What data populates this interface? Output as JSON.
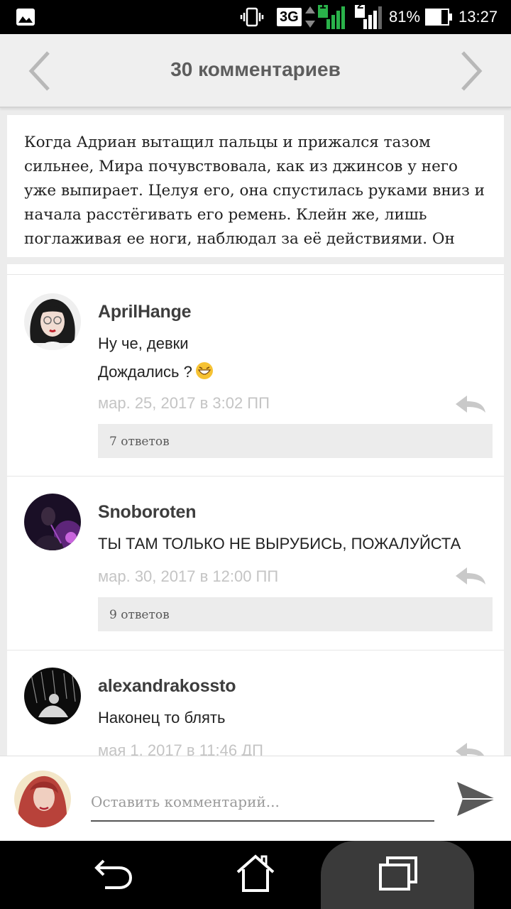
{
  "status_bar": {
    "network": "3G",
    "sim1": "1",
    "sim2": "2",
    "battery": "81%",
    "time": "13:27",
    "icons": [
      "image-notification-icon",
      "vibrate-icon",
      "signal-icon",
      "battery-icon"
    ]
  },
  "header": {
    "title": "30 комментариев"
  },
  "excerpt": {
    "text": "Когда Адриан вытащил пальцы и прижался тазом сильнее, Мира почувствовала, как из джинсов у него уже выпирает. Целуя его, она спустилась руками вниз и начала расстёгивать его ремень. Клейн же, лишь поглаживая ее ноги, наблюдал за её действиями. Он"
  },
  "comments": [
    {
      "username": "AprilHange",
      "lines": [
        "Ну че, девки",
        "Дождались ?"
      ],
      "emoji": "grinning-face-emoji",
      "time": "мар. 25, 2017 в 3:02 ПП",
      "replies": "7 ответов"
    },
    {
      "username": "Snoboroten",
      "lines": [
        "ТЫ ТАМ ТОЛЬКО НЕ ВЫРУБИСЬ, ПОЖАЛУЙСТА"
      ],
      "time": "мар. 30, 2017 в 12:00 ПП",
      "replies": "9 ответов"
    },
    {
      "username": "alexandrakossto",
      "lines": [
        "Наконец то блять"
      ],
      "time": "мая 1, 2017 в 11:46 ДП"
    }
  ],
  "composer": {
    "placeholder": "Оставить комментарий..."
  },
  "colors": {
    "accent_text": "#5d5d5d",
    "timestamp": "#c4c4c4",
    "background": "#ececec"
  }
}
